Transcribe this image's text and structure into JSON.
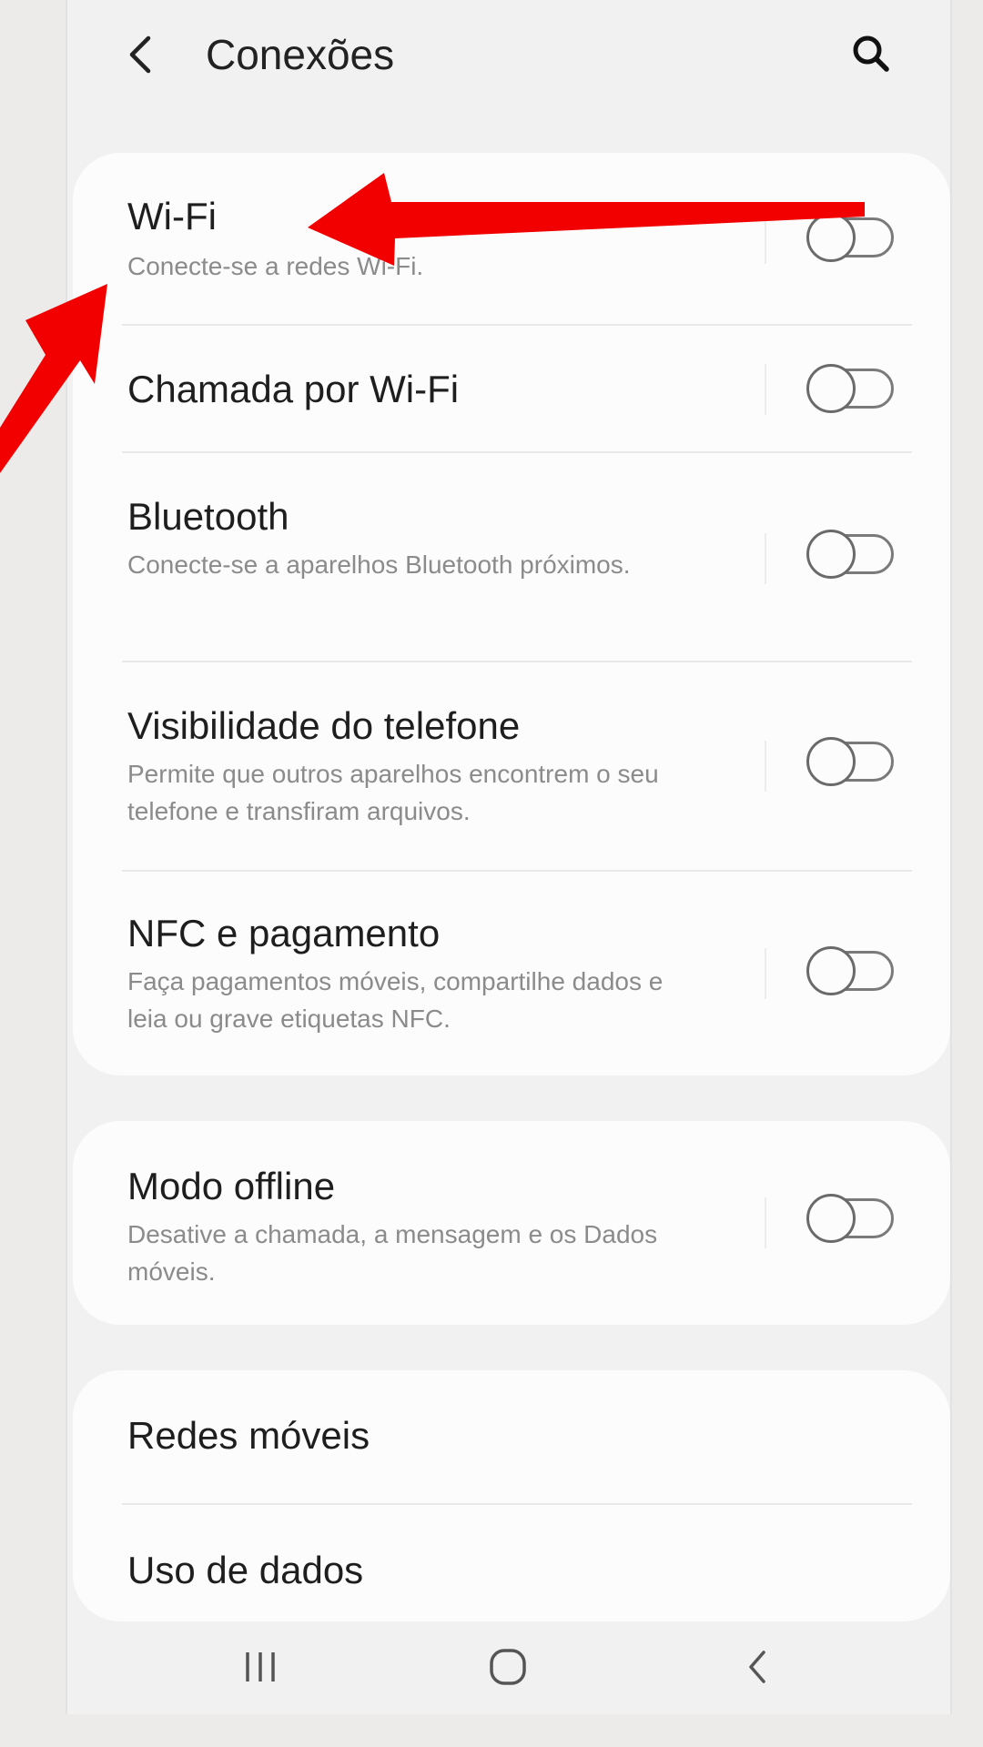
{
  "header": {
    "title": "Conexões",
    "back_icon": "chevron-left-icon",
    "search_icon": "search-icon"
  },
  "sections": [
    {
      "items": [
        {
          "title": "Wi-Fi",
          "subtitle": "Conecte-se a redes Wi-Fi.",
          "toggle": "off"
        },
        {
          "title": "Chamada por Wi-Fi",
          "subtitle": "",
          "toggle": "off"
        },
        {
          "title": "Bluetooth",
          "subtitle": "Conecte-se a aparelhos Bluetooth próximos.",
          "toggle": "off"
        },
        {
          "title": "Visibilidade do telefone",
          "subtitle": "Permite que outros aparelhos encontrem o seu telefone e transfiram arquivos.",
          "toggle": "off"
        },
        {
          "title": "NFC e pagamento",
          "subtitle": "Faça pagamentos móveis, compartilhe dados e leia ou grave etiquetas NFC.",
          "toggle": "off"
        }
      ]
    },
    {
      "items": [
        {
          "title": "Modo offline",
          "subtitle": "Desative a chamada, a mensagem e os Dados móveis.",
          "toggle": "off"
        }
      ]
    },
    {
      "items": [
        {
          "title": "Redes móveis"
        },
        {
          "title": "Uso de dados"
        }
      ]
    }
  ],
  "navbar": {
    "recents_icon": "recent-apps-icon",
    "home_icon": "home-icon",
    "back_icon": "back-icon"
  },
  "annotations": {
    "arrow_color": "#f20000",
    "arrows": [
      "arrow-pointing-to-wifi",
      "arrow-pointing-to-wifi-subtitle"
    ]
  },
  "colors": {
    "background": "#f1f1f1",
    "card": "#fcfcfc",
    "text_primary": "#1e1e1e",
    "text_secondary": "#8b8b8b"
  }
}
